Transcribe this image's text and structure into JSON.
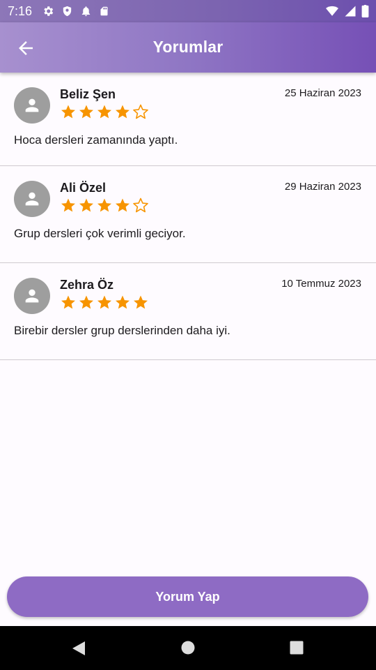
{
  "status_bar": {
    "time": "7:16",
    "left_icons": [
      "gear-icon",
      "shield-icon",
      "bell-icon",
      "sd-card-icon"
    ],
    "right_icons": [
      "wifi-icon",
      "signal-icon",
      "battery-icon"
    ]
  },
  "app_bar": {
    "title": "Yorumlar",
    "back_icon": "arrow-back-icon"
  },
  "reviews": [
    {
      "name": "Beliz Şen",
      "date": "25 Haziran 2023",
      "rating": 4,
      "max_rating": 5,
      "text": "Hoca dersleri zamanında yaptı."
    },
    {
      "name": "Ali Özel",
      "date": "29 Haziran 2023",
      "rating": 4,
      "max_rating": 5,
      "text": "Grup dersleri çok verimli geciyor."
    },
    {
      "name": "Zehra Öz",
      "date": "10 Temmuz 2023",
      "rating": 5,
      "max_rating": 5,
      "text": "Birebir dersler grup derslerinden daha iyi."
    }
  ],
  "comment_button": {
    "label": "Yorum Yap"
  },
  "colors": {
    "app_bar": "#8f76c4",
    "button": "#8e6bc4",
    "star": "#f79400",
    "avatar": "#9e9e9e"
  },
  "nav_bar": {
    "icons": [
      "nav-back-icon",
      "nav-home-icon",
      "nav-recents-icon"
    ]
  }
}
